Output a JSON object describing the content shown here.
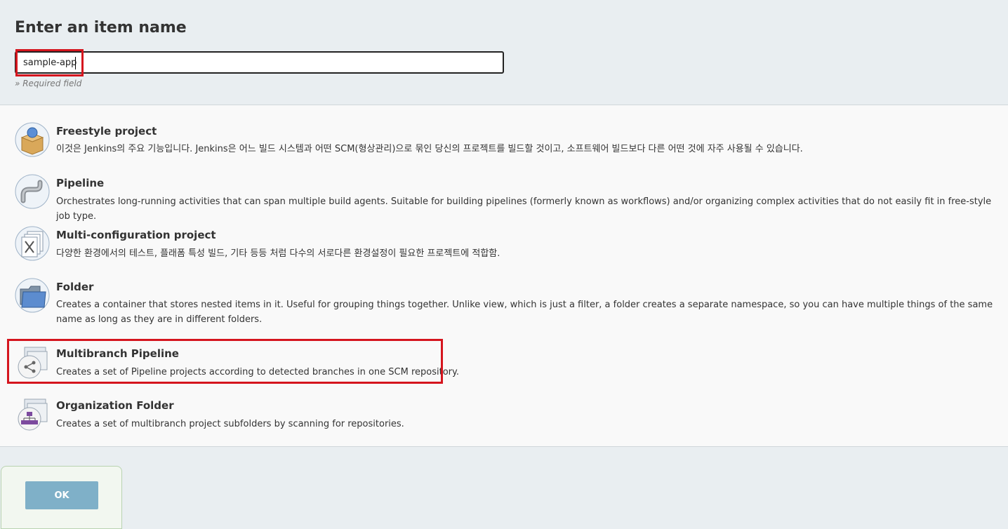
{
  "header": {
    "title": "Enter an item name",
    "item_name_value": "sample-app",
    "required_note": "» Required field"
  },
  "item_types": [
    {
      "title": "Freestyle project",
      "description": "이것은 Jenkins의 주요 기능입니다. Jenkins은 어느 빌드 시스템과 어떤 SCM(형상관리)으로 묶인 당신의 프로젝트를 빌드할 것이고, 소프트웨어 빌드보다 다른 어떤 것에 자주 사용될 수 있습니다.",
      "icon": "freestyle-box-icon"
    },
    {
      "title": "Pipeline",
      "description": "Orchestrates long-running activities that can span multiple build agents. Suitable for building pipelines (formerly known as workflows) and/or organizing complex activities that do not easily fit in free-style job type.",
      "icon": "pipeline-pipe-icon"
    },
    {
      "title": "Multi-configuration project",
      "description": "다양한 환경에서의 테스트, 플래폼 특성 빌드, 기타 등등 처럼 다수의 서로다른 환경설정이 필요한 프로젝트에 적합함.",
      "icon": "multi-config-icon"
    },
    {
      "title": "Folder",
      "description": "Creates a container that stores nested items in it. Useful for grouping things together. Unlike view, which is just a filter, a folder creates a separate namespace, so you can have multiple things of the same name as long as they are in different folders.",
      "icon": "folder-icon"
    },
    {
      "title": "Multibranch Pipeline",
      "description": "Creates a set of Pipeline projects according to detected branches in one SCM repository.",
      "icon": "multibranch-icon"
    },
    {
      "title": "Organization Folder",
      "description": "Creates a set of multibranch project subfolders by scanning for repositories.",
      "icon": "organization-folder-icon"
    }
  ],
  "footer": {
    "ok_label": "OK"
  },
  "colors": {
    "highlight": "#d5151e",
    "ok_button": "#7fb0c8"
  }
}
